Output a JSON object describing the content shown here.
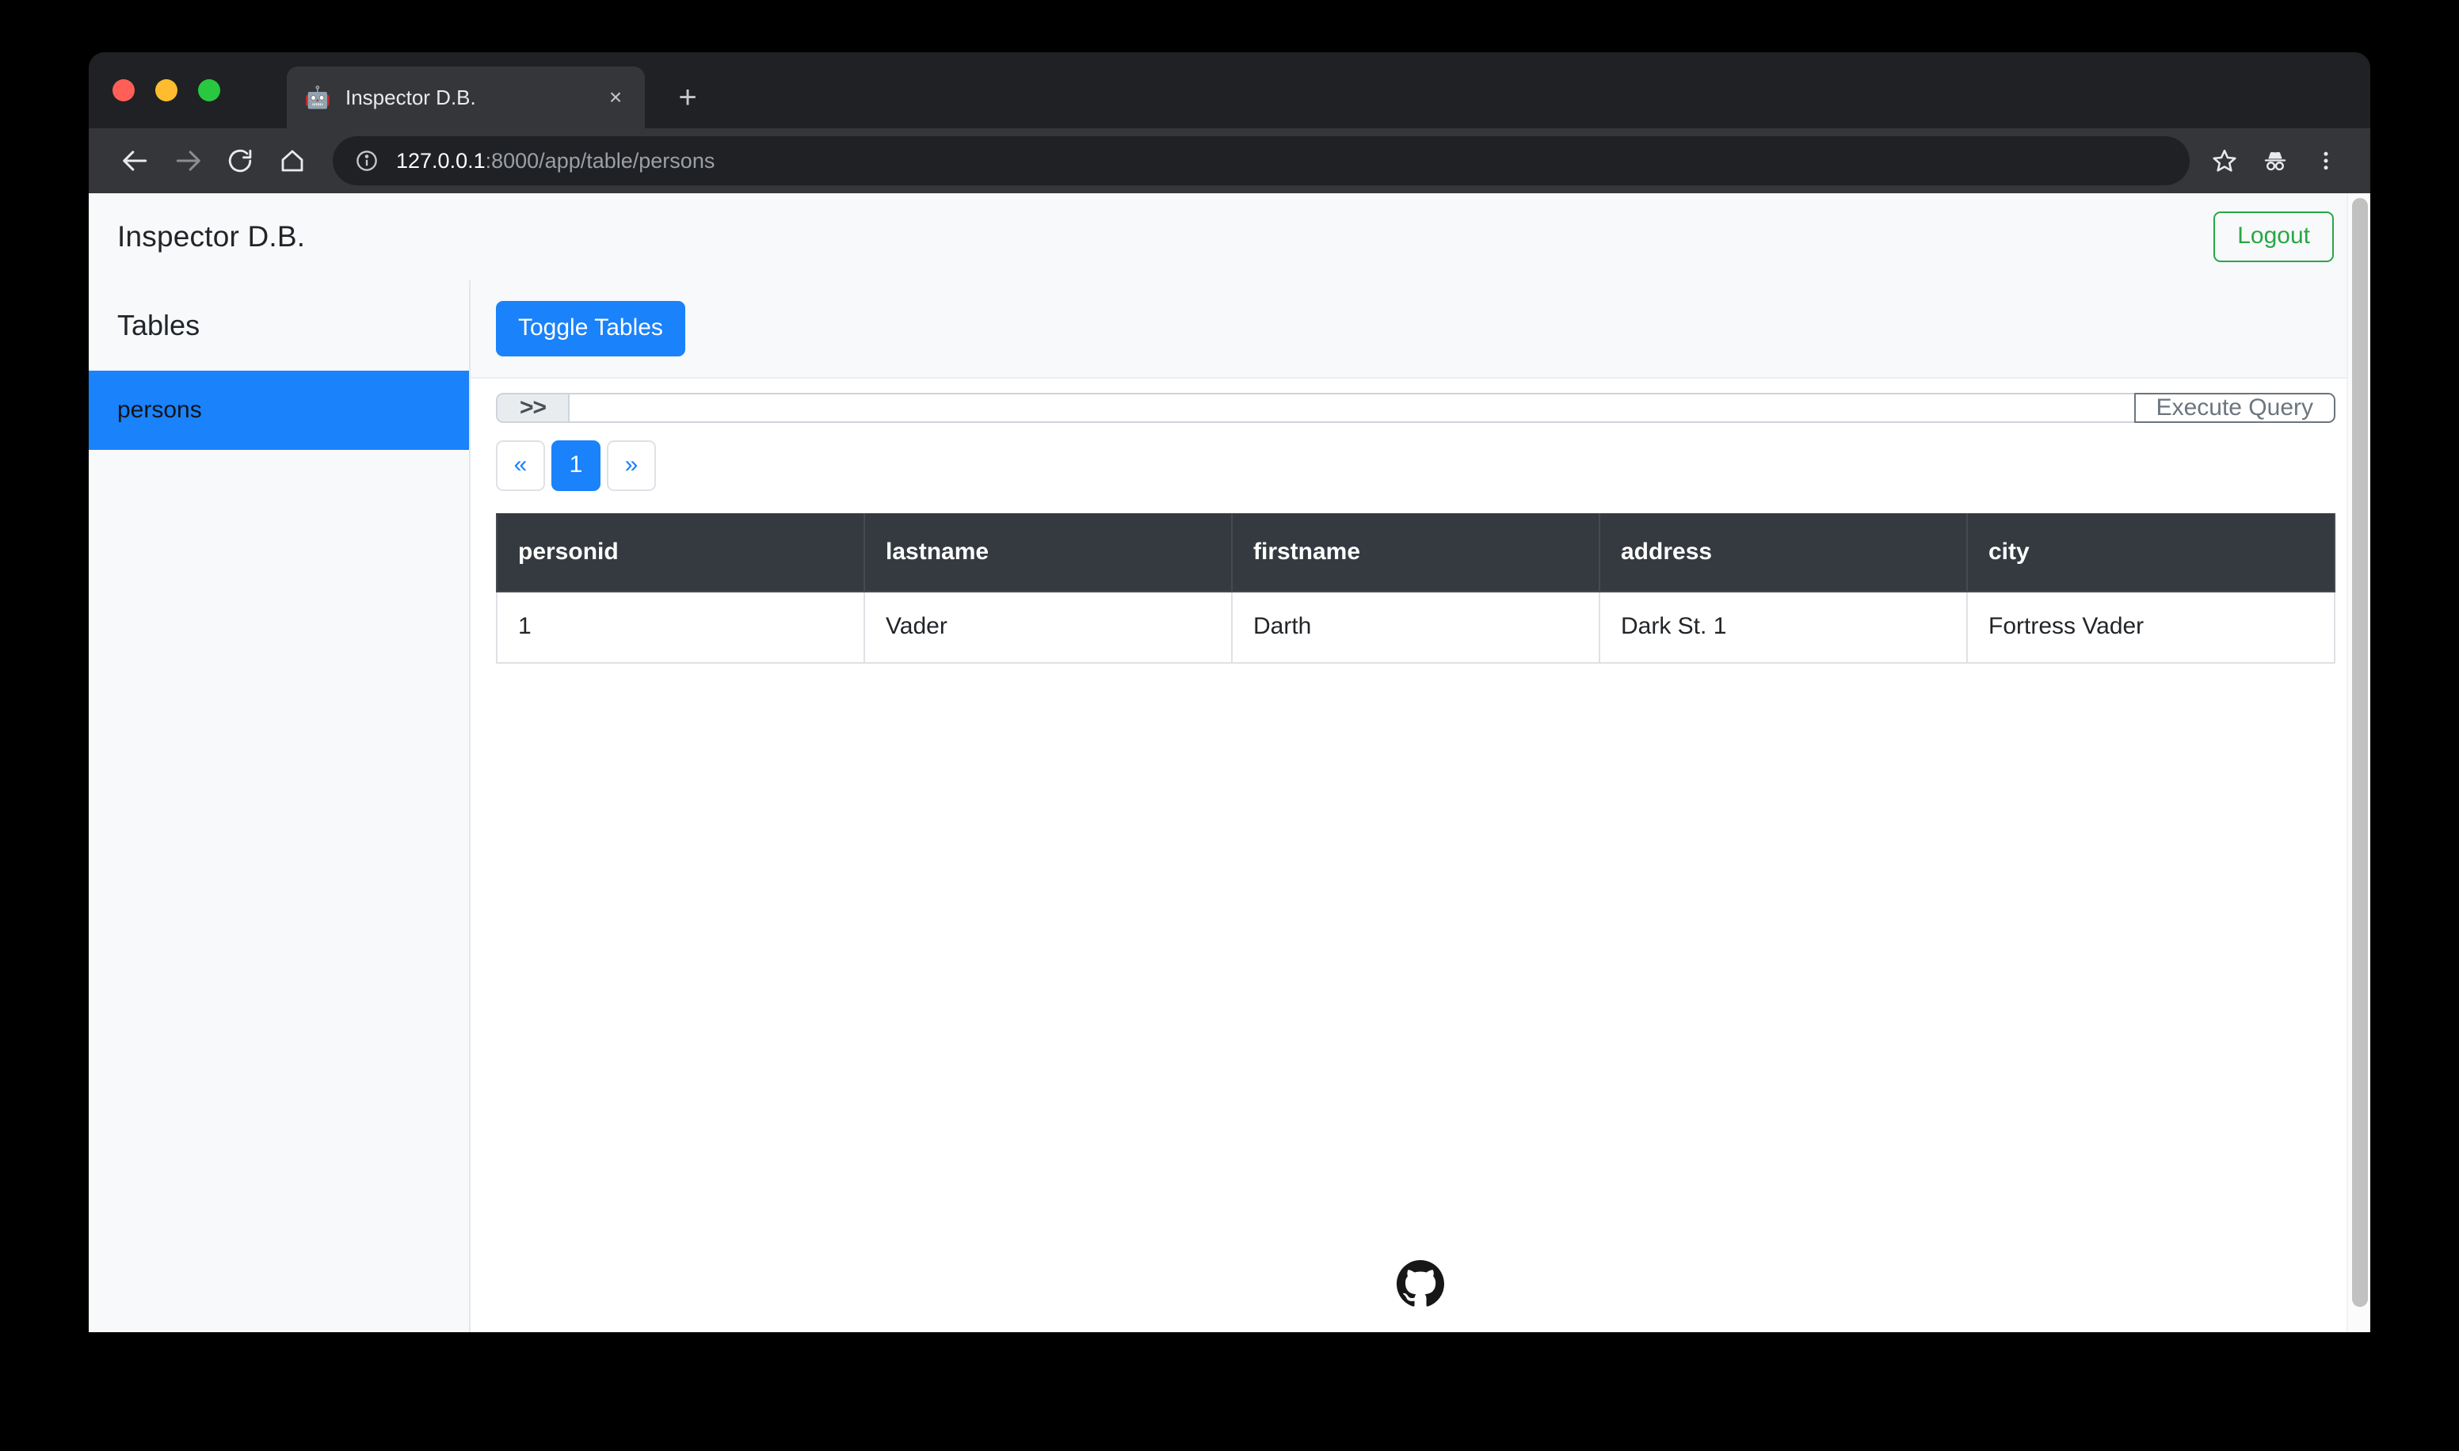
{
  "browser": {
    "tab": {
      "favicon": "detective-emoji",
      "title": "Inspector D.B.",
      "close_label": "×"
    },
    "new_tab_label": "+",
    "nav": {
      "back": "back-arrow",
      "forward": "forward-arrow",
      "reload": "reload",
      "home": "home"
    },
    "omnibox": {
      "info_icon": "info-circle",
      "url_host": "127.0.0.1",
      "url_path": ":8000/app/table/persons"
    },
    "toolbar_icons": [
      "bookmark-star",
      "incognito",
      "kebab-menu"
    ]
  },
  "app": {
    "title": "Inspector D.B.",
    "logout_label": "Logout"
  },
  "sidebar": {
    "heading": "Tables",
    "items": [
      {
        "label": "persons",
        "active": true
      }
    ]
  },
  "content": {
    "toggle_tables_label": "Toggle Tables",
    "query": {
      "prefix": ">>",
      "value": "",
      "placeholder": "",
      "execute_label": "Execute Query"
    },
    "pagination": {
      "prev_label": "«",
      "next_label": "»",
      "pages": [
        "1"
      ],
      "active_page": "1"
    },
    "table": {
      "columns": [
        "personid",
        "lastname",
        "firstname",
        "address",
        "city"
      ],
      "rows": [
        [
          "1",
          "Vader",
          "Darth",
          "Dark St. 1",
          "Fortress Vader"
        ]
      ]
    },
    "footer_icon": "github-logo"
  },
  "colors": {
    "primary": "#1a82fb",
    "success": "#28a745",
    "dark": "#343a40",
    "muted": "#6c757d",
    "light": "#f8f9fa"
  }
}
